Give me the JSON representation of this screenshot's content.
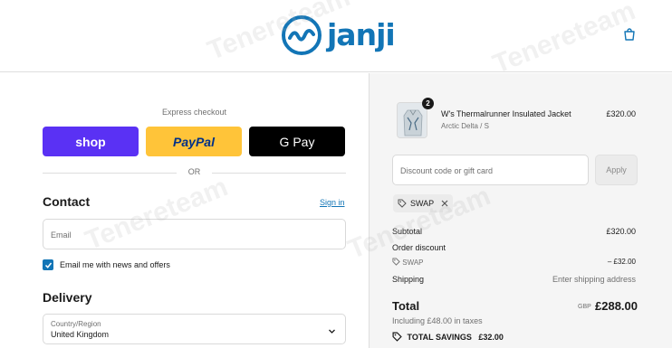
{
  "header": {
    "brand_text": "janji",
    "brand_icon": "janji-wave-logo",
    "cart_icon": "shopping-bag-icon"
  },
  "express": {
    "title": "Express checkout",
    "shop_label": "shop",
    "paypal_label": "PayPal",
    "gpay_label": "G Pay",
    "or_label": "OR"
  },
  "contact": {
    "heading": "Contact",
    "signin_label": "Sign in",
    "email_placeholder": "Email",
    "marketing_label": "Email me with news and offers",
    "marketing_checked": true
  },
  "delivery": {
    "heading": "Delivery",
    "country_label": "Country/Region",
    "country_value": "United Kingdom"
  },
  "summary": {
    "item": {
      "quantity": "2",
      "name": "W's Thermalrunner Insulated Jacket",
      "variant": "Arctic Delta / S",
      "price": "£320.00"
    },
    "discount_placeholder": "Discount code or gift card",
    "apply_label": "Apply",
    "applied_code": "SWAP",
    "subtotal_label": "Subtotal",
    "subtotal_value": "£320.00",
    "order_discount_label": "Order discount",
    "discount_code": "SWAP",
    "discount_value": "– £32.00",
    "shipping_label": "Shipping",
    "shipping_value": "Enter shipping address",
    "total_label": "Total",
    "currency": "GBP",
    "total_value": "£288.00",
    "taxes_note": "Including £48.00 in taxes",
    "savings_label": "TOTAL SAVINGS",
    "savings_value": "£32.00"
  },
  "watermark": "Tenereteam",
  "colors": {
    "brand": "#1275b6",
    "shop": "#5a31f4",
    "paypal": "#ffc439",
    "gpay": "#000000"
  }
}
